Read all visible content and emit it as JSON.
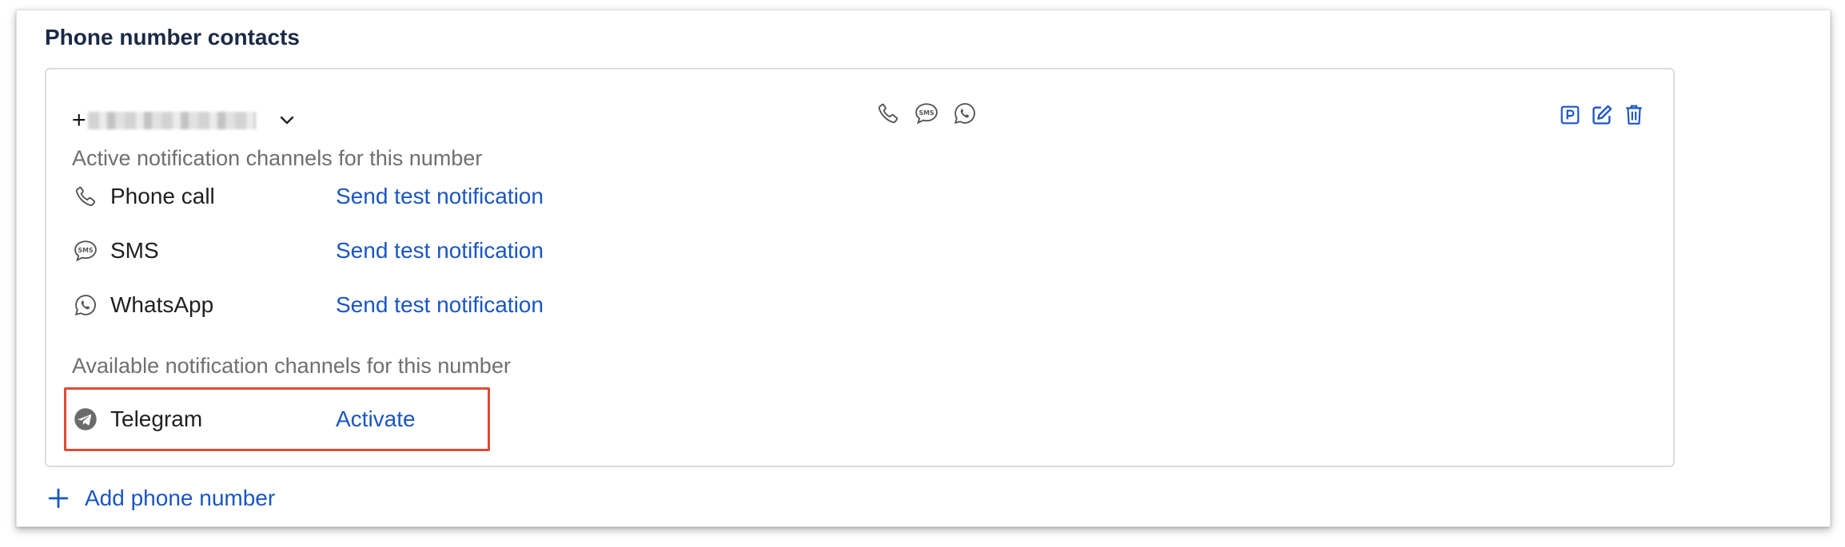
{
  "section": {
    "title": "Phone number contacts"
  },
  "phone": {
    "prefix": "+",
    "number_redacted": true,
    "channel_icons": [
      "phone-icon",
      "sms-icon",
      "whatsapp-icon"
    ],
    "actions": [
      "parking-icon",
      "edit-icon",
      "trash-icon"
    ]
  },
  "active": {
    "heading": "Active notification channels for this number",
    "channels": [
      {
        "icon": "phone-icon",
        "name": "Phone call",
        "action": "Send test notification"
      },
      {
        "icon": "sms-icon",
        "name": "SMS",
        "action": "Send test notification"
      },
      {
        "icon": "whatsapp-icon",
        "name": "WhatsApp",
        "action": "Send test notification"
      }
    ]
  },
  "available": {
    "heading": "Available notification channels for this number",
    "channels": [
      {
        "icon": "telegram-icon",
        "name": "Telegram",
        "action": "Activate"
      }
    ]
  },
  "add": {
    "label": "Add phone number"
  },
  "colors": {
    "link": "#1a56c2",
    "title": "#1b2a45",
    "highlight": "#e04a33",
    "muted": "#6f6f6f"
  }
}
